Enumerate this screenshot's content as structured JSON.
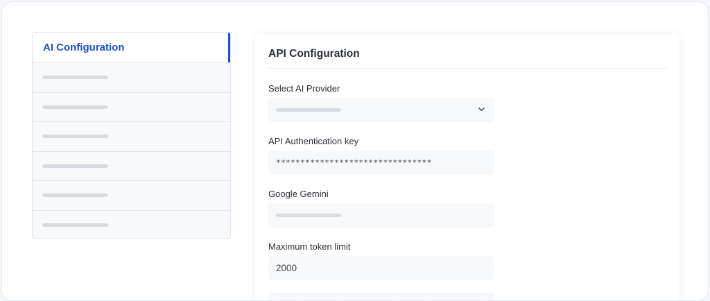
{
  "sidebar": {
    "active_label": "AI Configuration",
    "items": [
      "",
      "",
      "",
      "",
      "",
      ""
    ]
  },
  "panel": {
    "title": "API Configuration",
    "fields": {
      "provider": {
        "label": "Select AI Provider",
        "value": ""
      },
      "auth_key": {
        "label": "API Authentication key",
        "value": "********************************"
      },
      "gemini": {
        "label": "Google Gemini",
        "value": ""
      },
      "token_limit": {
        "label": "Maximum token limit",
        "value": "2000"
      }
    }
  },
  "colors": {
    "accent": "#1d4fd8",
    "field_bg": "#f6f8fa",
    "placeholder": "#d7dbe2"
  },
  "icons": {
    "dropdown": "chevron-down-icon"
  }
}
